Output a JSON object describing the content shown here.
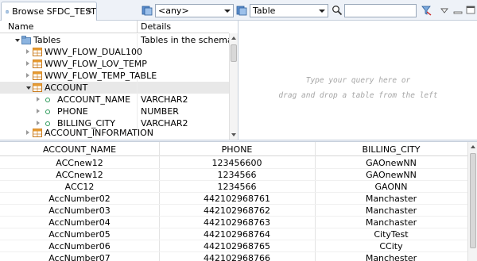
{
  "toolbar": {
    "tab_label": "Browse SFDC_TEST",
    "tab_close": "✕",
    "schema_combo": "<any>",
    "type_combo": "Table",
    "search_value": "",
    "icons": [
      "database-icon",
      "table-filter-icon",
      "search-icon",
      "clear-filter-icon",
      "view-menu-icon",
      "minimize-icon",
      "maximize-icon"
    ]
  },
  "tree": {
    "col_name": "Name",
    "col_details": "Details",
    "rows": [
      {
        "label": "Tables",
        "details": "Tables in the schema"
      },
      {
        "label": "WWV_FLOW_DUAL100",
        "details": ""
      },
      {
        "label": "WWV_FLOW_LOV_TEMP",
        "details": ""
      },
      {
        "label": "WWV_FLOW_TEMP_TABLE",
        "details": ""
      },
      {
        "label": "ACCOUNT",
        "details": ""
      },
      {
        "label": "ACCOUNT_NAME",
        "details": "VARCHAR2"
      },
      {
        "label": "PHONE",
        "details": "NUMBER"
      },
      {
        "label": "BILLING_CITY",
        "details": "VARCHAR2"
      },
      {
        "label": "ACCOUNT_INFORMATION",
        "details": ""
      }
    ]
  },
  "query": {
    "hint_line1": "Type your query here or",
    "hint_line2": "drag and drop a table from the left"
  },
  "results": {
    "columns": [
      "ACCOUNT_NAME",
      "PHONE",
      "BILLING_CITY"
    ],
    "rows": [
      [
        "ACCnew12",
        "123456600",
        "GAOnewNN"
      ],
      [
        "ACCnew12",
        "1234566",
        "GAOnewNN"
      ],
      [
        "ACC12",
        "1234566",
        "GAONN"
      ],
      [
        "AccNumber02",
        "442102968761",
        "Manchaster"
      ],
      [
        "AccNumber03",
        "442102968762",
        "Manchaster"
      ],
      [
        "AccNumber04",
        "442102968763",
        "Manchaster"
      ],
      [
        "AccNumber05",
        "442102968764",
        "CityTest"
      ],
      [
        "AccNumber06",
        "442102968765",
        "CCity"
      ],
      [
        "AccNumber07",
        "442102968766",
        "Manchester"
      ]
    ]
  }
}
